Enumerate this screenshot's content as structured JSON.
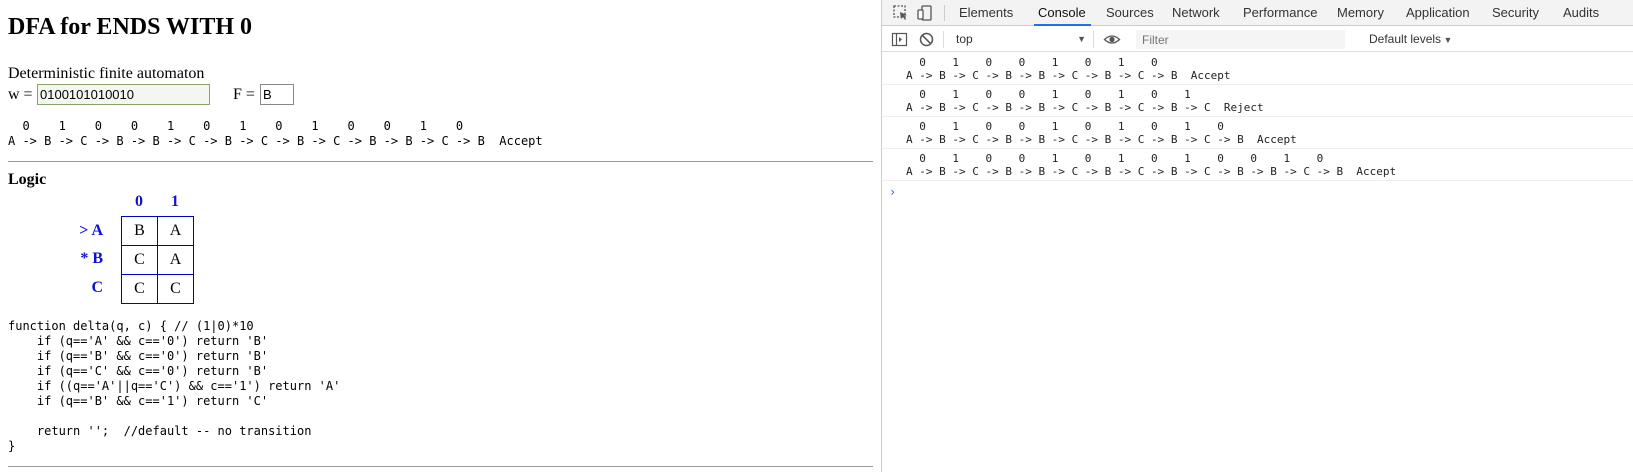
{
  "page": {
    "title": "DFA for ENDS WITH 0",
    "subtitle": "Deterministic finite automaton",
    "w_label": "w =",
    "w_value": "0100101010010",
    "f_label": "F =",
    "f_value": "B",
    "trace_input": "  0    1    0    0    1    0    1    0    1    0    0    1    0",
    "trace_states": "A -> B -> C -> B -> B -> C -> B -> C -> B -> C -> B -> B -> C -> B  Accept",
    "logic_heading": "Logic",
    "table": {
      "columns": [
        "0",
        "1"
      ],
      "rows": [
        {
          "label": "> A",
          "cells": [
            "B",
            "A"
          ]
        },
        {
          "label": "* B",
          "cells": [
            "C",
            "A"
          ]
        },
        {
          "label": "C",
          "cells": [
            "C",
            "C"
          ]
        }
      ]
    },
    "code": "function delta(q, c) { // (1|0)*10\n    if (q=='A' && c=='0') return 'B'\n    if (q=='B' && c=='0') return 'B'\n    if (q=='C' && c=='0') return 'B'\n    if ((q=='A'||q=='C') && c=='1') return 'A'\n    if (q=='B' && c=='1') return 'C'\n\n    return '';  //default -- no transition\n}"
  },
  "devtools": {
    "tabs": [
      "Elements",
      "Console",
      "Sources",
      "Network",
      "Performance",
      "Memory",
      "Application",
      "Security",
      "Audits"
    ],
    "active_tab": "Console",
    "context": "top",
    "filter_placeholder": "Filter",
    "levels": "Default levels",
    "prompt": "›",
    "logs": [
      "  0    1    0    0    1    0    1    0\nA -> B -> C -> B -> B -> C -> B -> C -> B  Accept",
      "  0    1    0    0    1    0    1    0    1\nA -> B -> C -> B -> B -> C -> B -> C -> B -> C  Reject",
      "  0    1    0    0    1    0    1    0    1    0\nA -> B -> C -> B -> B -> C -> B -> C -> B -> C -> B  Accept",
      "  0    1    0    0    1    0    1    0    1    0    0    1    0\nA -> B -> C -> B -> B -> C -> B -> C -> B -> C -> B -> B -> C -> B  Accept"
    ],
    "accent": "#1a73e8"
  }
}
